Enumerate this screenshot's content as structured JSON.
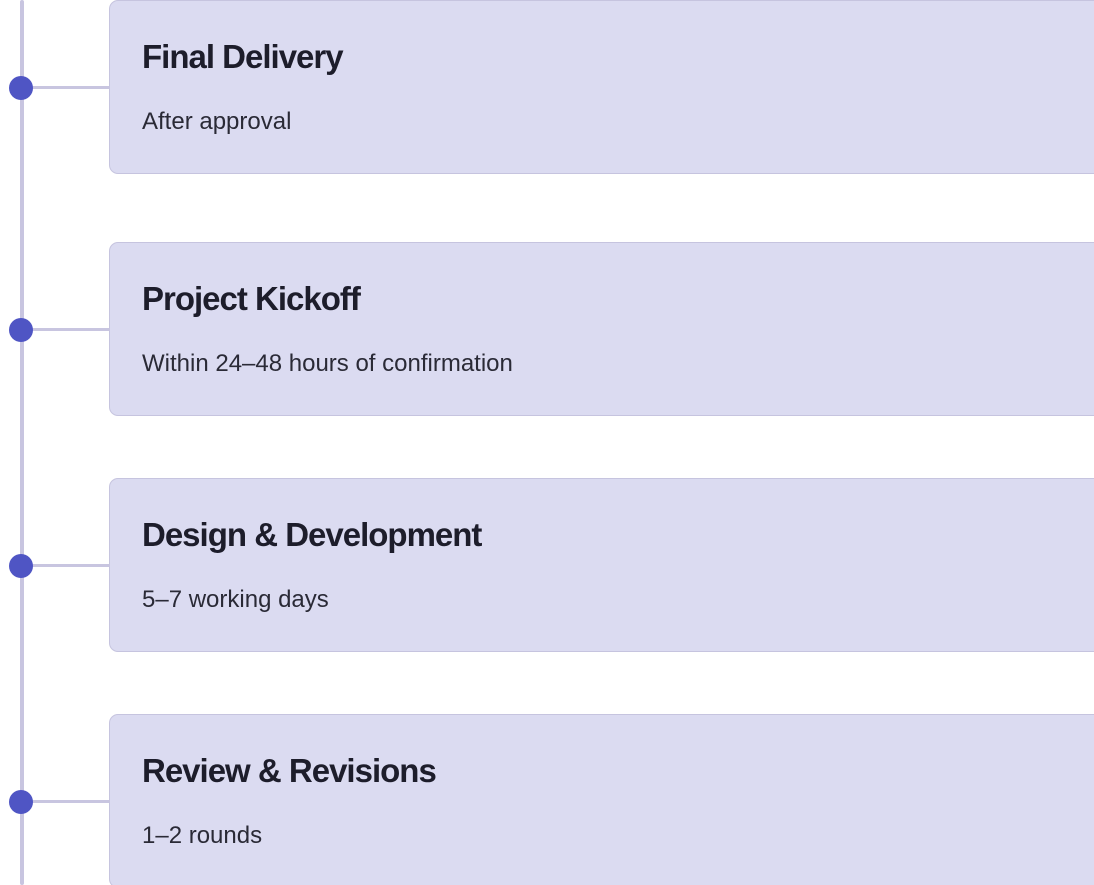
{
  "timeline": {
    "steps": [
      {
        "title": "Project Kickoff",
        "subtitle": "Within 24–48 hours of confirmation"
      },
      {
        "title": "Design & Development",
        "subtitle": "5–7 working days"
      },
      {
        "title": "Review & Revisions",
        "subtitle": "1–2 rounds"
      },
      {
        "title": "Final Delivery",
        "subtitle": "After approval"
      }
    ]
  },
  "colors": {
    "dot": "#4f55c4",
    "line": "#c8c5e0",
    "card_background": "#dbdbf1",
    "card_border": "#c6c4df",
    "title_text": "#1d1d2b"
  }
}
